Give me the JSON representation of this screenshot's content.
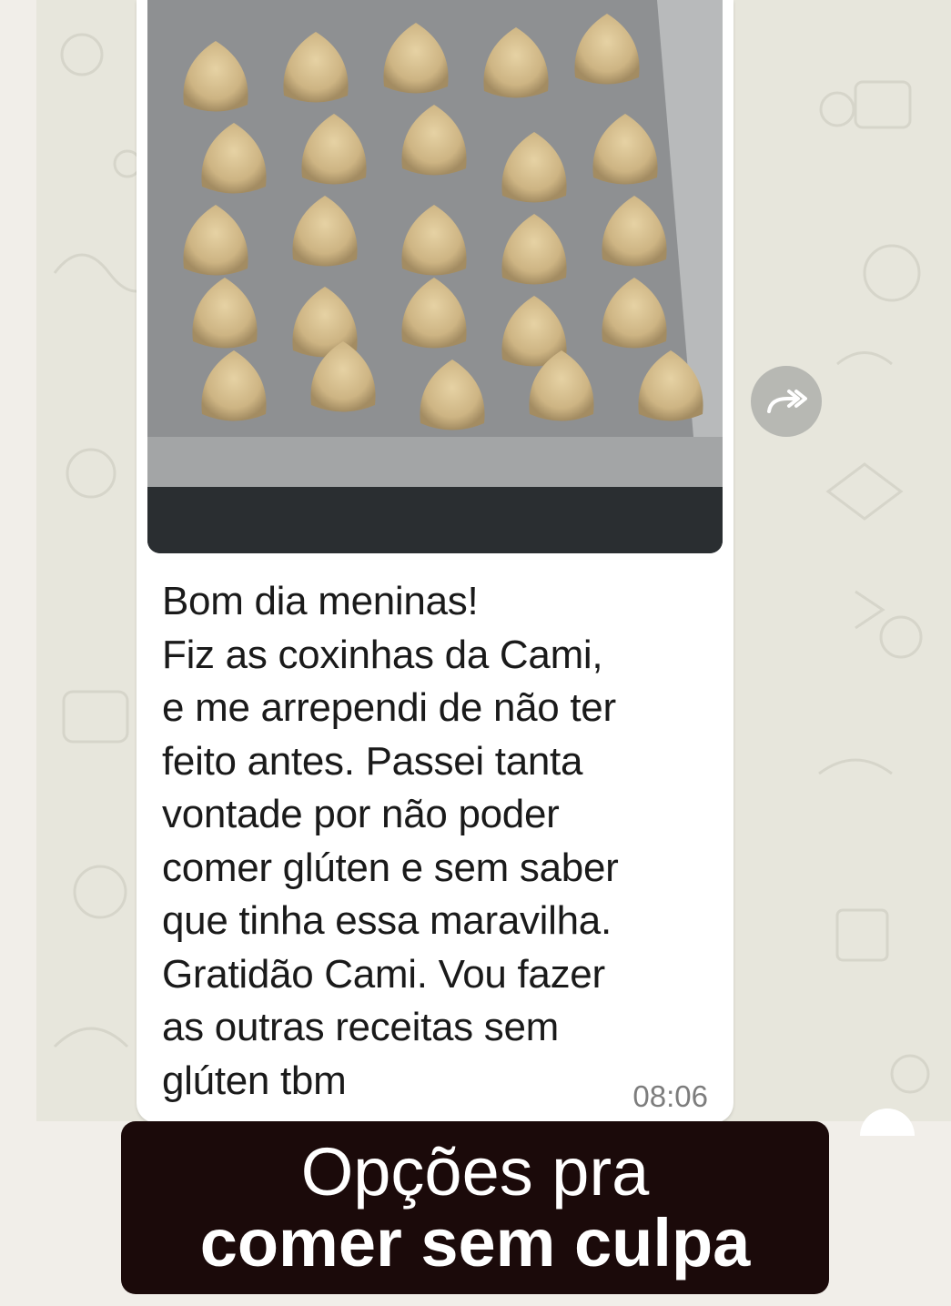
{
  "chat": {
    "message": {
      "text": "Bom dia meninas!\nFiz as coxinhas da Cami,\ne me arrependi de não ter\nfeito antes. Passei tanta\nvontade por não poder\ncomer glúten e sem saber\nque tinha essa maravilha.\nGratidão Cami. Vou fazer\nas outras receitas sem\nglúten tbm",
      "time": "08:06",
      "image_icon": "photo-coxinhas-on-baking-tray"
    },
    "forward_icon": "forward-icon"
  },
  "banner": {
    "line1": "Opções pra",
    "line2": "comer sem culpa"
  },
  "colors": {
    "chat_background": "#e7e6dc",
    "bubble": "#ffffff",
    "banner": "#1b0a0a",
    "forward_button": "#b7b8b3"
  }
}
